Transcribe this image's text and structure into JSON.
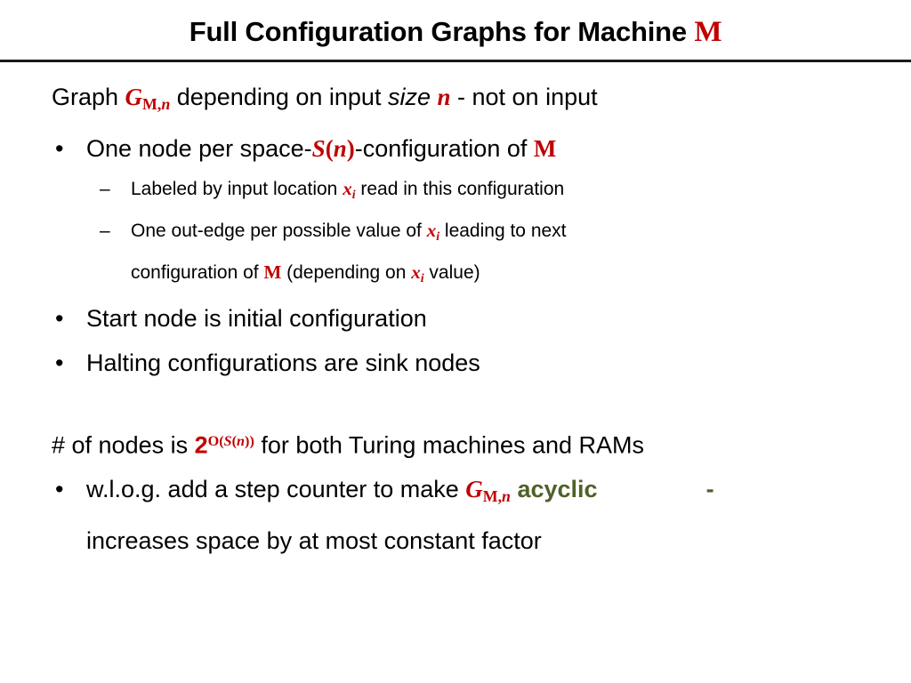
{
  "slide": {
    "title_prefix": "Full Configuration Graphs for Machine ",
    "title_machine": "M",
    "accent_red": "#C00000",
    "accent_green": "#4F6228",
    "rule_color": "#1a1a1a",
    "background": "#ffffff"
  },
  "body": {
    "line1": {
      "pre": "Graph ",
      "var_g": "G",
      "var_g_sub": "M,",
      "var_g_sub_italic": "n",
      "mid": " depending on input ",
      "italic_size": "size",
      "space": " ",
      "var_n": "n",
      "post": " - not on input"
    },
    "line2": {
      "bullet": "•",
      "pre": "One node per space-",
      "var_s": "S",
      "paren_open": "(",
      "var_n": "n",
      "paren_close": ")",
      "mid": "-configuration of ",
      "machine": "M"
    },
    "line3": {
      "bullet": "–",
      "pre": "Labeled by input location ",
      "var_x": "x",
      "var_x_sub": "i",
      "post": " read in this configuration"
    },
    "line4": {
      "bullet": "–",
      "pre": "One out-edge per possible value of ",
      "var_x": "x",
      "var_x_sub": "i",
      "post": " leading to next"
    },
    "line5": {
      "pre": "configuration of ",
      "machine": "M",
      "mid": " (depending on ",
      "var_x": "x",
      "var_x_sub": "i",
      "post": " value)"
    },
    "line6": {
      "bullet": "•",
      "text": "Start node is initial configuration"
    },
    "line7": {
      "bullet": "•",
      "text": "Halting configurations are sink nodes"
    },
    "line8": {
      "pre": "# of nodes is ",
      "base_two": "2",
      "exp_o": "O",
      "exp_paren_open": "(",
      "exp_s": "S",
      "exp_inner_open": "(",
      "exp_n": "n",
      "exp_inner_close": ")",
      "exp_paren_close": ")",
      "post": " for both Turing machines and RAMs"
    },
    "line9": {
      "bullet": "•",
      "pre": "w.l.o.g. add a step counter to make ",
      "var_g": "G",
      "var_g_sub": "M,",
      "var_g_sub_italic": "n",
      "space": " ",
      "emphasis": "acyclic",
      "trailing": "-"
    },
    "line10": {
      "text": "increases space by at most constant factor"
    }
  }
}
